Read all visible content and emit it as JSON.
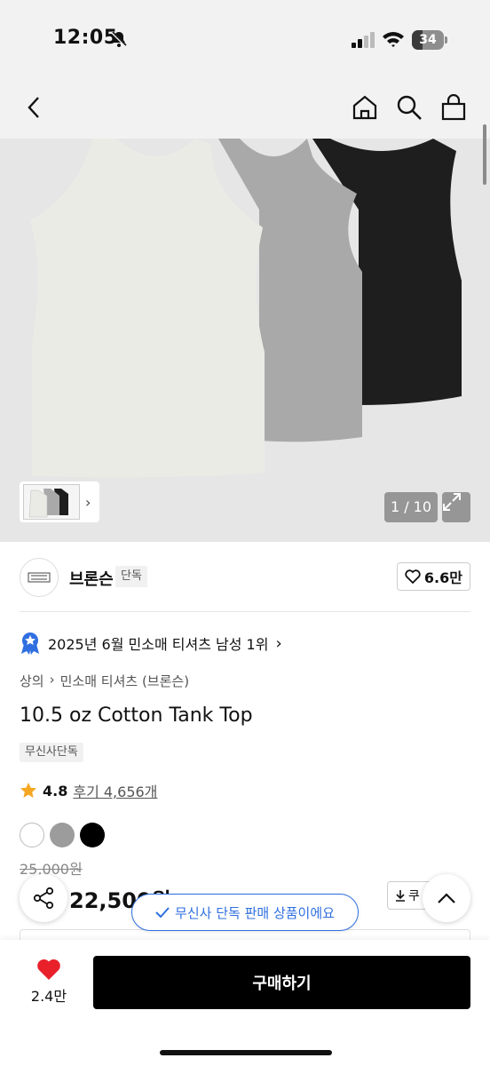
{
  "status_bar": {
    "time": "12:05",
    "battery": "34",
    "battery_level": 0.34,
    "icons": [
      "bell-off-icon",
      "signal-icon",
      "wifi-icon",
      "battery-icon"
    ]
  },
  "nav": {
    "icons": [
      "back-icon",
      "home-icon",
      "search-icon",
      "cart-icon"
    ]
  },
  "gallery": {
    "page_indicator": "1 / 10",
    "product_colors": [
      "#ebebe6",
      "#a9a9a9",
      "#1e1e1e"
    ]
  },
  "brand": {
    "name": "브론슨",
    "tag": "단독",
    "likes": "6.6만"
  },
  "ranking": {
    "text": "2025년 6월 민소매 티셔츠 남성 1위"
  },
  "breadcrumb": {
    "items": [
      "상의",
      "민소매 티셔츠 (브론슨)"
    ]
  },
  "product": {
    "title": "10.5 oz Cotton Tank Top",
    "exclusive_tag": "무신사단독",
    "rating": "4.8",
    "reviews": "후기 4,656개",
    "swatch_colors": [
      "#ffffff",
      "#9c9c9c",
      "#000000"
    ],
    "original_price": "25,000원",
    "sale_price": "22,500원",
    "coupon_label": "쿠"
  },
  "toast": {
    "text": "무신사 단독 판매 상품이에요"
  },
  "bottom_bar": {
    "heart_count": "2.4만",
    "buy_label": "구매하기"
  },
  "colors": {
    "accent_blue": "#2f6fe0",
    "heart_red": "#e8202a",
    "star_orange": "#f5a623"
  }
}
